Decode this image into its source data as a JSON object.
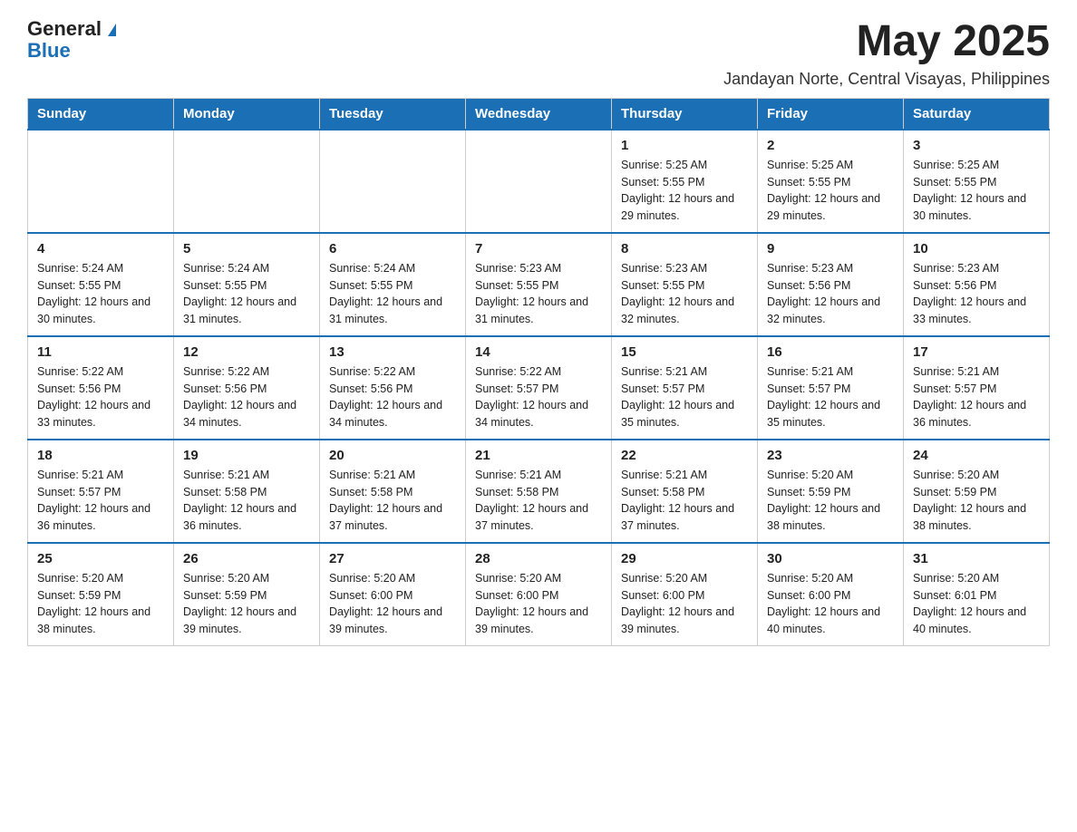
{
  "header": {
    "logo_general": "General",
    "logo_blue": "Blue",
    "month_year": "May 2025",
    "location": "Jandayan Norte, Central Visayas, Philippines"
  },
  "days_of_week": [
    "Sunday",
    "Monday",
    "Tuesday",
    "Wednesday",
    "Thursday",
    "Friday",
    "Saturday"
  ],
  "weeks": [
    [
      {
        "day": "",
        "sunrise": "",
        "sunset": "",
        "daylight": ""
      },
      {
        "day": "",
        "sunrise": "",
        "sunset": "",
        "daylight": ""
      },
      {
        "day": "",
        "sunrise": "",
        "sunset": "",
        "daylight": ""
      },
      {
        "day": "",
        "sunrise": "",
        "sunset": "",
        "daylight": ""
      },
      {
        "day": "1",
        "sunrise": "Sunrise: 5:25 AM",
        "sunset": "Sunset: 5:55 PM",
        "daylight": "Daylight: 12 hours and 29 minutes."
      },
      {
        "day": "2",
        "sunrise": "Sunrise: 5:25 AM",
        "sunset": "Sunset: 5:55 PM",
        "daylight": "Daylight: 12 hours and 29 minutes."
      },
      {
        "day": "3",
        "sunrise": "Sunrise: 5:25 AM",
        "sunset": "Sunset: 5:55 PM",
        "daylight": "Daylight: 12 hours and 30 minutes."
      }
    ],
    [
      {
        "day": "4",
        "sunrise": "Sunrise: 5:24 AM",
        "sunset": "Sunset: 5:55 PM",
        "daylight": "Daylight: 12 hours and 30 minutes."
      },
      {
        "day": "5",
        "sunrise": "Sunrise: 5:24 AM",
        "sunset": "Sunset: 5:55 PM",
        "daylight": "Daylight: 12 hours and 31 minutes."
      },
      {
        "day": "6",
        "sunrise": "Sunrise: 5:24 AM",
        "sunset": "Sunset: 5:55 PM",
        "daylight": "Daylight: 12 hours and 31 minutes."
      },
      {
        "day": "7",
        "sunrise": "Sunrise: 5:23 AM",
        "sunset": "Sunset: 5:55 PM",
        "daylight": "Daylight: 12 hours and 31 minutes."
      },
      {
        "day": "8",
        "sunrise": "Sunrise: 5:23 AM",
        "sunset": "Sunset: 5:55 PM",
        "daylight": "Daylight: 12 hours and 32 minutes."
      },
      {
        "day": "9",
        "sunrise": "Sunrise: 5:23 AM",
        "sunset": "Sunset: 5:56 PM",
        "daylight": "Daylight: 12 hours and 32 minutes."
      },
      {
        "day": "10",
        "sunrise": "Sunrise: 5:23 AM",
        "sunset": "Sunset: 5:56 PM",
        "daylight": "Daylight: 12 hours and 33 minutes."
      }
    ],
    [
      {
        "day": "11",
        "sunrise": "Sunrise: 5:22 AM",
        "sunset": "Sunset: 5:56 PM",
        "daylight": "Daylight: 12 hours and 33 minutes."
      },
      {
        "day": "12",
        "sunrise": "Sunrise: 5:22 AM",
        "sunset": "Sunset: 5:56 PM",
        "daylight": "Daylight: 12 hours and 34 minutes."
      },
      {
        "day": "13",
        "sunrise": "Sunrise: 5:22 AM",
        "sunset": "Sunset: 5:56 PM",
        "daylight": "Daylight: 12 hours and 34 minutes."
      },
      {
        "day": "14",
        "sunrise": "Sunrise: 5:22 AM",
        "sunset": "Sunset: 5:57 PM",
        "daylight": "Daylight: 12 hours and 34 minutes."
      },
      {
        "day": "15",
        "sunrise": "Sunrise: 5:21 AM",
        "sunset": "Sunset: 5:57 PM",
        "daylight": "Daylight: 12 hours and 35 minutes."
      },
      {
        "day": "16",
        "sunrise": "Sunrise: 5:21 AM",
        "sunset": "Sunset: 5:57 PM",
        "daylight": "Daylight: 12 hours and 35 minutes."
      },
      {
        "day": "17",
        "sunrise": "Sunrise: 5:21 AM",
        "sunset": "Sunset: 5:57 PM",
        "daylight": "Daylight: 12 hours and 36 minutes."
      }
    ],
    [
      {
        "day": "18",
        "sunrise": "Sunrise: 5:21 AM",
        "sunset": "Sunset: 5:57 PM",
        "daylight": "Daylight: 12 hours and 36 minutes."
      },
      {
        "day": "19",
        "sunrise": "Sunrise: 5:21 AM",
        "sunset": "Sunset: 5:58 PM",
        "daylight": "Daylight: 12 hours and 36 minutes."
      },
      {
        "day": "20",
        "sunrise": "Sunrise: 5:21 AM",
        "sunset": "Sunset: 5:58 PM",
        "daylight": "Daylight: 12 hours and 37 minutes."
      },
      {
        "day": "21",
        "sunrise": "Sunrise: 5:21 AM",
        "sunset": "Sunset: 5:58 PM",
        "daylight": "Daylight: 12 hours and 37 minutes."
      },
      {
        "day": "22",
        "sunrise": "Sunrise: 5:21 AM",
        "sunset": "Sunset: 5:58 PM",
        "daylight": "Daylight: 12 hours and 37 minutes."
      },
      {
        "day": "23",
        "sunrise": "Sunrise: 5:20 AM",
        "sunset": "Sunset: 5:59 PM",
        "daylight": "Daylight: 12 hours and 38 minutes."
      },
      {
        "day": "24",
        "sunrise": "Sunrise: 5:20 AM",
        "sunset": "Sunset: 5:59 PM",
        "daylight": "Daylight: 12 hours and 38 minutes."
      }
    ],
    [
      {
        "day": "25",
        "sunrise": "Sunrise: 5:20 AM",
        "sunset": "Sunset: 5:59 PM",
        "daylight": "Daylight: 12 hours and 38 minutes."
      },
      {
        "day": "26",
        "sunrise": "Sunrise: 5:20 AM",
        "sunset": "Sunset: 5:59 PM",
        "daylight": "Daylight: 12 hours and 39 minutes."
      },
      {
        "day": "27",
        "sunrise": "Sunrise: 5:20 AM",
        "sunset": "Sunset: 6:00 PM",
        "daylight": "Daylight: 12 hours and 39 minutes."
      },
      {
        "day": "28",
        "sunrise": "Sunrise: 5:20 AM",
        "sunset": "Sunset: 6:00 PM",
        "daylight": "Daylight: 12 hours and 39 minutes."
      },
      {
        "day": "29",
        "sunrise": "Sunrise: 5:20 AM",
        "sunset": "Sunset: 6:00 PM",
        "daylight": "Daylight: 12 hours and 39 minutes."
      },
      {
        "day": "30",
        "sunrise": "Sunrise: 5:20 AM",
        "sunset": "Sunset: 6:00 PM",
        "daylight": "Daylight: 12 hours and 40 minutes."
      },
      {
        "day": "31",
        "sunrise": "Sunrise: 5:20 AM",
        "sunset": "Sunset: 6:01 PM",
        "daylight": "Daylight: 12 hours and 40 minutes."
      }
    ]
  ]
}
